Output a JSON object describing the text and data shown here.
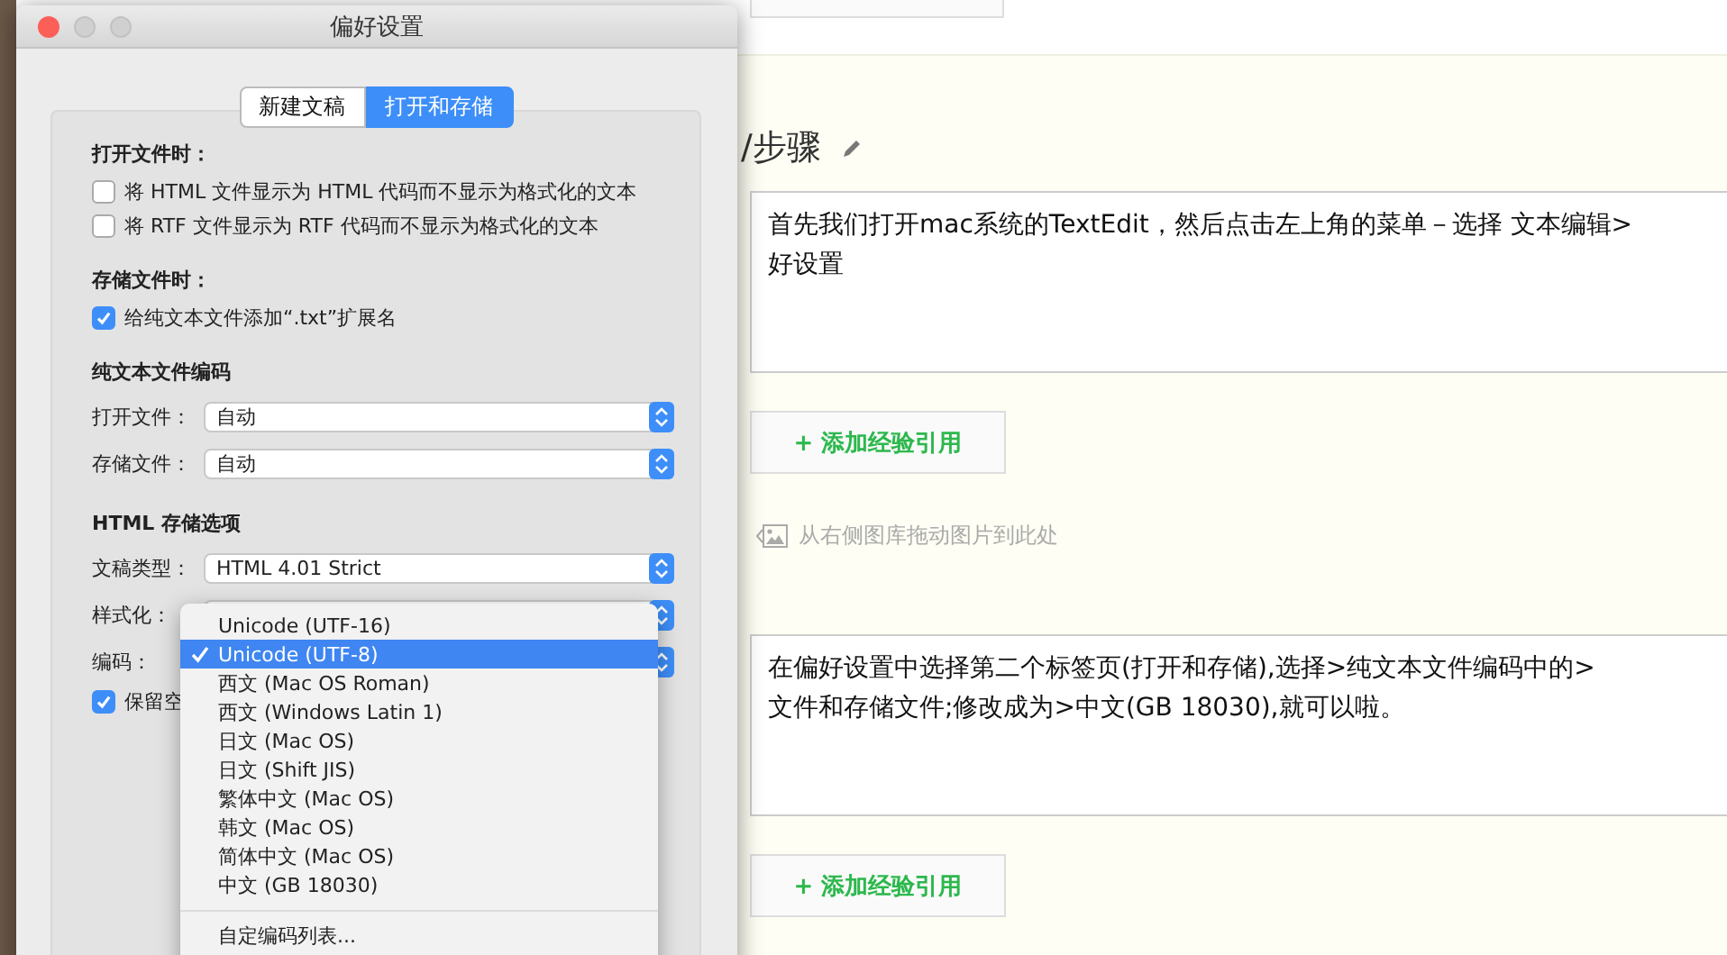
{
  "dialog": {
    "title": "偏好设置",
    "tabs": [
      {
        "label": "新建文稿",
        "selected": false
      },
      {
        "label": "打开和存储",
        "selected": true
      }
    ],
    "rows": [
      {
        "kind": "heading",
        "label": "打开文件时："
      },
      {
        "kind": "checkbox",
        "label": "将 HTML 文件显示为 HTML 代码而不显示为格式化的文本",
        "checked": false
      },
      {
        "kind": "checkbox",
        "label": "将 RTF 文件显示为 RTF 代码而不显示为格式化的文本",
        "checked": false
      },
      {
        "kind": "heading",
        "label": "存储文件时："
      },
      {
        "kind": "checkbox",
        "label": "给纯文本文件添加“.txt”扩展名",
        "checked": true
      },
      {
        "kind": "heading",
        "label": "纯文本文件编码"
      },
      {
        "kind": "select",
        "label": "打开文件：",
        "value": "自动"
      },
      {
        "kind": "select",
        "label": "存储文件：",
        "value": "自动"
      },
      {
        "kind": "heading",
        "label": "HTML 存储选项"
      },
      {
        "kind": "select",
        "label": "文稿类型：",
        "value": "HTML 4.01 Strict"
      },
      {
        "kind": "select",
        "label": "样式化："
      },
      {
        "kind": "select",
        "label": "编码："
      },
      {
        "kind": "checkbox",
        "label": "保留空",
        "checked": true
      }
    ],
    "menu": {
      "items": [
        {
          "label": "Unicode (UTF-16)",
          "selected": false
        },
        {
          "label": "Unicode (UTF-8)",
          "selected": true
        },
        {
          "label": "西文 (Mac OS Roman)",
          "selected": false
        },
        {
          "label": "西文 (Windows Latin 1)",
          "selected": false
        },
        {
          "label": "日文 (Mac OS)",
          "selected": false
        },
        {
          "label": "日文 (Shift JIS)",
          "selected": false
        },
        {
          "label": "繁体中文 (Mac OS)",
          "selected": false
        },
        {
          "label": "韩文 (Mac OS)",
          "selected": false
        },
        {
          "label": "简体中文 (Mac OS)",
          "selected": false
        },
        {
          "label": "中文 (GB 18030)",
          "selected": false
        }
      ],
      "footer": "自定编码列表..."
    }
  },
  "page": {
    "heading": "/步骤",
    "blocks": [
      {
        "kind": "text",
        "lines": [
          "首先我们打开mac系统的TextEdit，然后点击左上角的菜单－选择 文本编辑>",
          "好设置"
        ]
      },
      {
        "kind": "button",
        "label": "+ 添加经验引用"
      },
      {
        "kind": "hint",
        "label": "从右侧图库拖动图片到此处"
      },
      {
        "kind": "text",
        "lines": [
          "在偏好设置中选择第二个标签页(打开和存储),选择>纯文本文件编码中的>",
          "文件和存储文件;修改成为>中文(GB 18030),就可以啦。"
        ]
      },
      {
        "kind": "button",
        "label": "+ 添加经验引用"
      }
    ]
  }
}
